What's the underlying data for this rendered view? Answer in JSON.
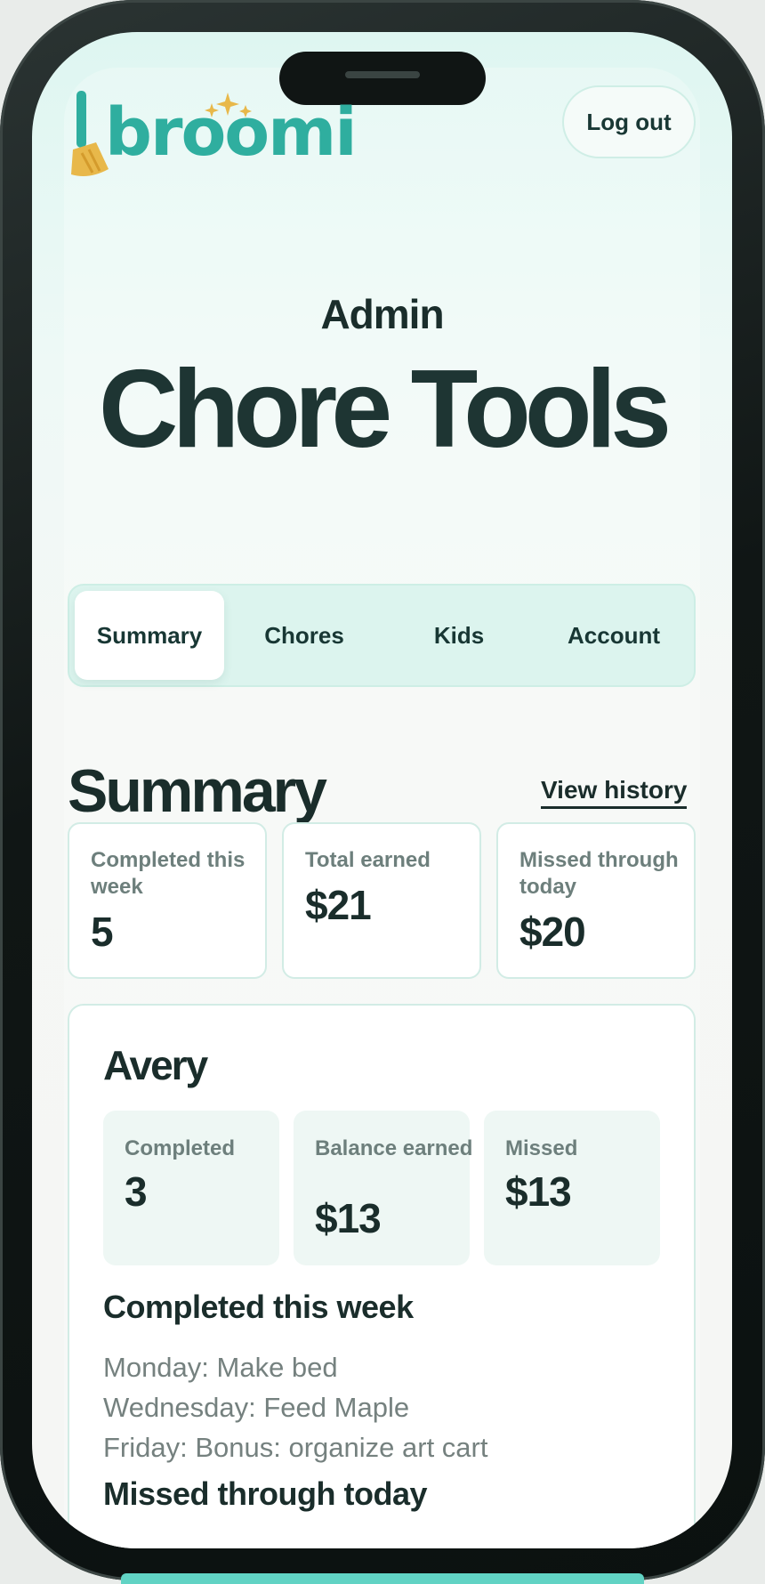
{
  "brand": {
    "name": "broomi",
    "color": "#2fae9f",
    "accent": "#e8b84a"
  },
  "header": {
    "logout_label": "Log out"
  },
  "hero": {
    "subtitle": "Admin",
    "title": "Chore Tools"
  },
  "tabs": [
    {
      "label": "Summary",
      "active": true
    },
    {
      "label": "Chores",
      "active": false
    },
    {
      "label": "Kids",
      "active": false
    },
    {
      "label": "Account",
      "active": false
    }
  ],
  "summary": {
    "title": "Summary",
    "view_history_label": "View history",
    "stats": [
      {
        "label": "Completed this week",
        "value": "5"
      },
      {
        "label": "Total earned",
        "value": "$21"
      },
      {
        "label": "Missed through today",
        "value": "$20"
      }
    ]
  },
  "kid": {
    "name": "Avery",
    "stats": [
      {
        "label": "Completed",
        "value": "3"
      },
      {
        "label": "Balance earned",
        "value": "$13"
      },
      {
        "label": "Missed",
        "value": "$13"
      }
    ],
    "completed_heading": "Completed this week",
    "completed_items": [
      "Monday: Make bed",
      "Wednesday: Feed Maple",
      "Friday: Bonus: organize art cart"
    ],
    "missed_heading": "Missed through today"
  }
}
